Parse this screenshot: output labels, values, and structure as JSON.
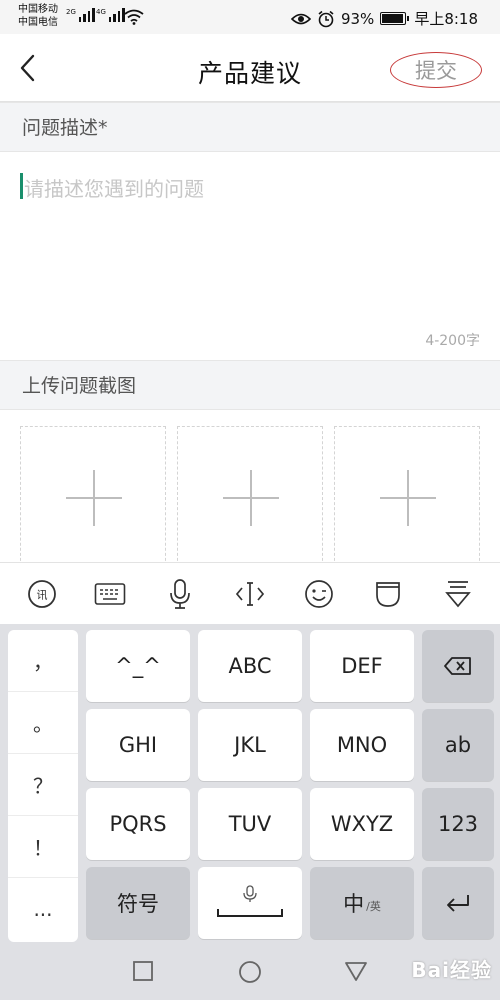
{
  "status_bar": {
    "carrier1": "中国移动",
    "carrier2": "中国电信",
    "sig1_label": "2G",
    "sig2_label": "4G",
    "battery_percent": "93%",
    "battery_level": 0.93,
    "time": "早上8:18"
  },
  "header": {
    "title": "产品建议",
    "submit_label": "提交",
    "accent_color": "#c73a3a"
  },
  "description": {
    "section_label": "问题描述*",
    "placeholder": "请描述您遇到的问题",
    "counter": "4-200字"
  },
  "upload": {
    "section_label": "上传问题截图",
    "slots": 3
  },
  "keyboard_toolbar": [
    "logo-icon",
    "keyboard-icon",
    "microphone-icon",
    "cursor-icon",
    "emoji-icon",
    "clipboard-icon",
    "collapse-icon"
  ],
  "keyboard": {
    "punctuation": [
      "，",
      "。",
      "？",
      "！",
      "..."
    ],
    "row1": [
      "^_^",
      "ABC",
      "DEF"
    ],
    "row2": [
      "GHI",
      "JKL",
      "MNO"
    ],
    "row3": [
      "PQRS",
      "TUV",
      "WXYZ"
    ],
    "side_ab": "ab",
    "side_123": "123",
    "symbols": "符号",
    "lang_main": "中",
    "lang_sub": "/英"
  },
  "watermark": "Bai经验"
}
